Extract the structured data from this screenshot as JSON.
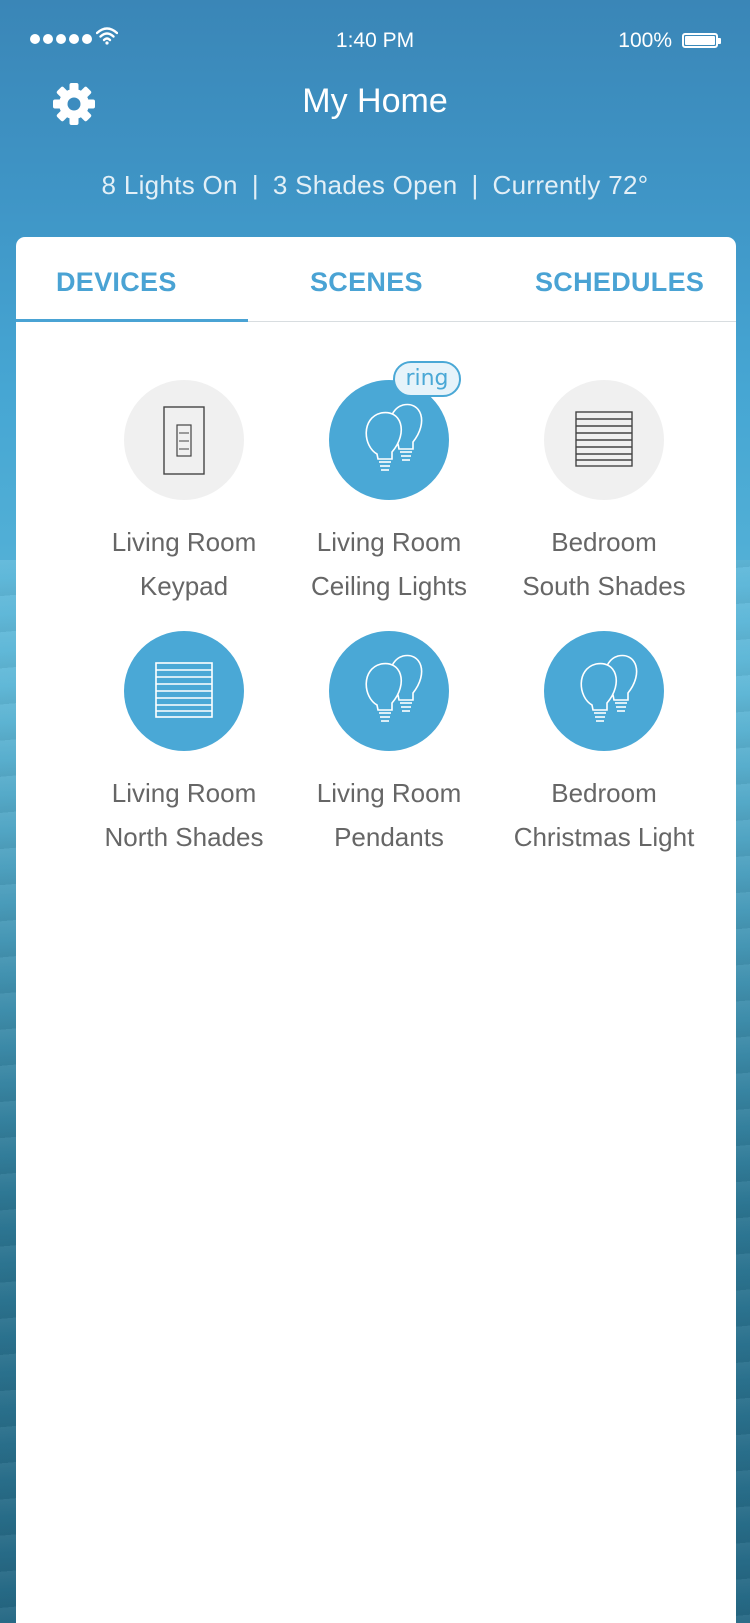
{
  "status_bar": {
    "time": "1:40 PM",
    "battery": "100%"
  },
  "header": {
    "title": "My Home",
    "summary": {
      "lights": "8 Lights On",
      "shades": "3 Shades Open",
      "temperature": "Currently 72°",
      "separator": "|"
    },
    "settings_icon": "gear-icon"
  },
  "tabs": [
    {
      "label": "DEVICES",
      "selected": true
    },
    {
      "label": "SCENES",
      "selected": false
    },
    {
      "label": "SCHEDULES",
      "selected": false
    }
  ],
  "devices": [
    {
      "line1": "Living Room",
      "line2": "Keypad",
      "icon": "keypad-icon",
      "on": false
    },
    {
      "line1": "Living Room",
      "line2": "Ceiling Lights",
      "icon": "light-bulbs-icon",
      "on": true,
      "badge": "ring"
    },
    {
      "line1": "Bedroom",
      "line2": "South Shades",
      "icon": "shade-icon",
      "on": false
    },
    {
      "line1": "Living Room",
      "line2": "North Shades",
      "icon": "shade-icon",
      "on": true
    },
    {
      "line1": "Living Room",
      "line2": "Pendants",
      "icon": "light-bulbs-icon",
      "on": true
    },
    {
      "line1": "Bedroom",
      "line2": "Christmas Light",
      "icon": "light-bulbs-icon",
      "on": true
    }
  ],
  "colors": {
    "accent": "#4aa8d6",
    "tab_text": "#4aa3d4",
    "off_circle": "#f0f0f0",
    "label_text": "#666666"
  }
}
